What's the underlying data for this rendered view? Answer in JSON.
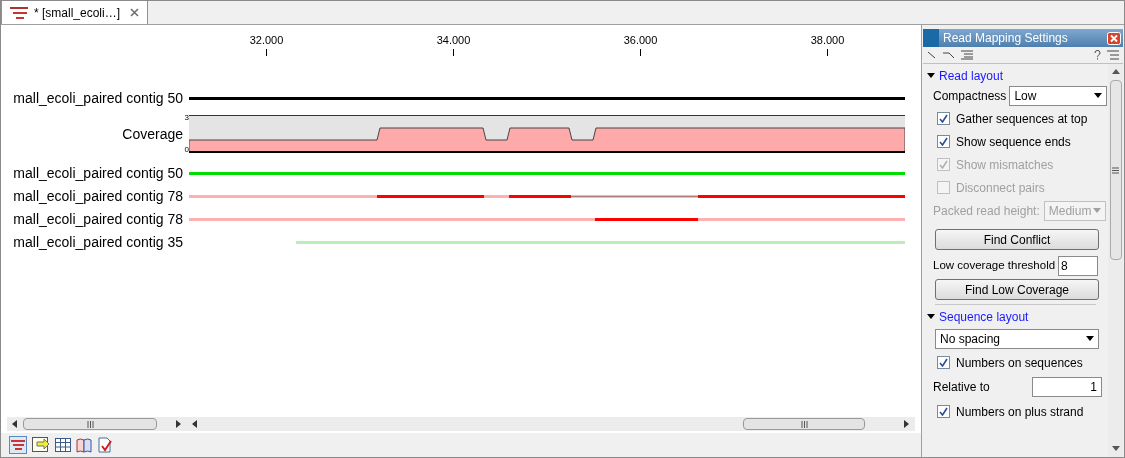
{
  "tab": {
    "title": "* [small_ecoli…]",
    "selected": true
  },
  "ruler": {
    "ticks": [
      "32.000",
      "34.000",
      "36.000",
      "38.000"
    ]
  },
  "tracks": [
    {
      "kind": "sequence",
      "label": "mall_ecoli_paired contig 50",
      "color": "#000000"
    },
    {
      "kind": "coverage",
      "label": "Coverage",
      "max": "3",
      "min": "0"
    },
    {
      "kind": "read",
      "label": "mall_ecoli_paired contig 50",
      "color": "#00dd00"
    },
    {
      "kind": "read",
      "label": "mall_ecoli_paired contig 78",
      "color": "#ffb0b0"
    },
    {
      "kind": "read",
      "label": "mall_ecoli_paired contig 78",
      "color": "#ffb0b0"
    },
    {
      "kind": "read",
      "label": "mall_ecoli_paired contig 35",
      "color": "#b8f0b8"
    }
  ],
  "panel": {
    "title": "Read Mapping Settings",
    "read_layout": {
      "title": "Read layout",
      "expanded": true,
      "compactness_label": "Compactness",
      "compactness": "Low",
      "options": [
        {
          "label": "Gather sequences at top",
          "checked": true,
          "disabled": false
        },
        {
          "label": "Show sequence ends",
          "checked": true,
          "disabled": false
        },
        {
          "label": "Show mismatches",
          "checked": true,
          "disabled": true
        },
        {
          "label": "Disconnect pairs",
          "checked": false,
          "disabled": true
        }
      ],
      "packed_label": "Packed read height:",
      "packed_value": "Medium",
      "packed_disabled": true,
      "find_conflict": "Find Conflict",
      "threshold_label": "Low coverage threshold",
      "threshold": "8",
      "find_low": "Find Low Coverage"
    },
    "sequence_layout": {
      "title": "Sequence layout",
      "expanded": true,
      "spacing": "No spacing",
      "numbers_on_sequences": {
        "label": "Numbers on sequences",
        "checked": true
      },
      "relative_label": "Relative to",
      "relative_value": "1",
      "plus_strand": {
        "label": "Numbers on plus strand",
        "checked": true
      }
    }
  }
}
